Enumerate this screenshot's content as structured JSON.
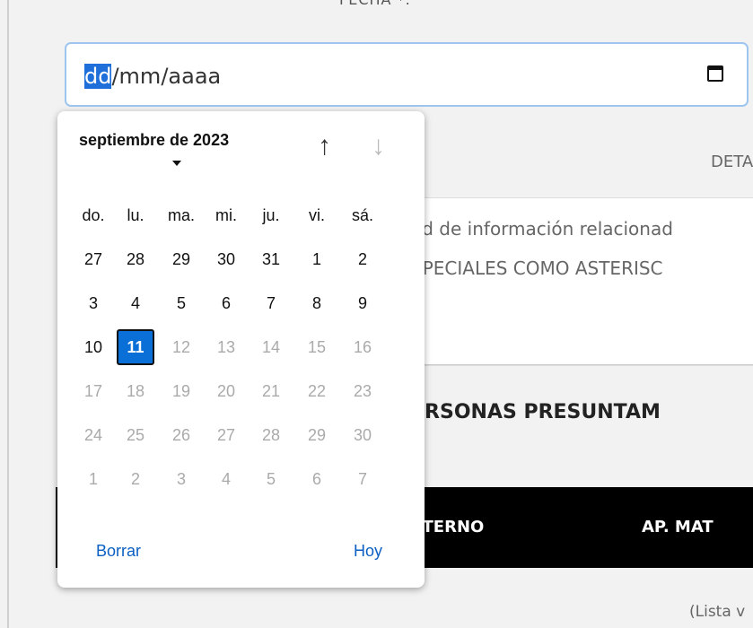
{
  "form": {
    "field_label": "FECHA *:",
    "date_format_day": "dd",
    "date_format_rest": "/mm/aaaa",
    "detail_label": "DETAL",
    "textarea_line1": "ad de información relacionad",
    "textarea_line2": "SPECIALES COMO ASTERISC",
    "section_title": "ERSONAS PRESUNTAM",
    "table_headers": [
      "ATERNO",
      "AP. MAT"
    ],
    "table_empty": "(Lista v"
  },
  "datepicker": {
    "month_label": "septiembre de 2023",
    "weekdays": [
      "do.",
      "lu.",
      "ma.",
      "mi.",
      "ju.",
      "vi.",
      "sá."
    ],
    "weeks": [
      [
        {
          "d": "27",
          "m": false
        },
        {
          "d": "28",
          "m": false
        },
        {
          "d": "29",
          "m": false
        },
        {
          "d": "30",
          "m": false
        },
        {
          "d": "31",
          "m": false
        },
        {
          "d": "1",
          "m": false
        },
        {
          "d": "2",
          "m": false
        }
      ],
      [
        {
          "d": "3",
          "m": false
        },
        {
          "d": "4",
          "m": false
        },
        {
          "d": "5",
          "m": false
        },
        {
          "d": "6",
          "m": false
        },
        {
          "d": "7",
          "m": false
        },
        {
          "d": "8",
          "m": false
        },
        {
          "d": "9",
          "m": false
        }
      ],
      [
        {
          "d": "10",
          "m": false
        },
        {
          "d": "11",
          "m": false,
          "today": true
        },
        {
          "d": "12",
          "m": true
        },
        {
          "d": "13",
          "m": true
        },
        {
          "d": "14",
          "m": true
        },
        {
          "d": "15",
          "m": true
        },
        {
          "d": "16",
          "m": true
        }
      ],
      [
        {
          "d": "17",
          "m": true
        },
        {
          "d": "18",
          "m": true
        },
        {
          "d": "19",
          "m": true
        },
        {
          "d": "20",
          "m": true
        },
        {
          "d": "21",
          "m": true
        },
        {
          "d": "22",
          "m": true
        },
        {
          "d": "23",
          "m": true
        }
      ],
      [
        {
          "d": "24",
          "m": true
        },
        {
          "d": "25",
          "m": true
        },
        {
          "d": "26",
          "m": true
        },
        {
          "d": "27",
          "m": true
        },
        {
          "d": "28",
          "m": true
        },
        {
          "d": "29",
          "m": true
        },
        {
          "d": "30",
          "m": true
        }
      ],
      [
        {
          "d": "1",
          "m": true
        },
        {
          "d": "2",
          "m": true
        },
        {
          "d": "3",
          "m": true
        },
        {
          "d": "4",
          "m": true
        },
        {
          "d": "5",
          "m": true
        },
        {
          "d": "6",
          "m": true
        },
        {
          "d": "7",
          "m": true
        }
      ]
    ],
    "clear_label": "Borrar",
    "today_label": "Hoy",
    "nav_up_icon": "arrow-up-icon",
    "nav_down_icon": "arrow-down-icon",
    "accent_color": "#0b6fd8"
  }
}
